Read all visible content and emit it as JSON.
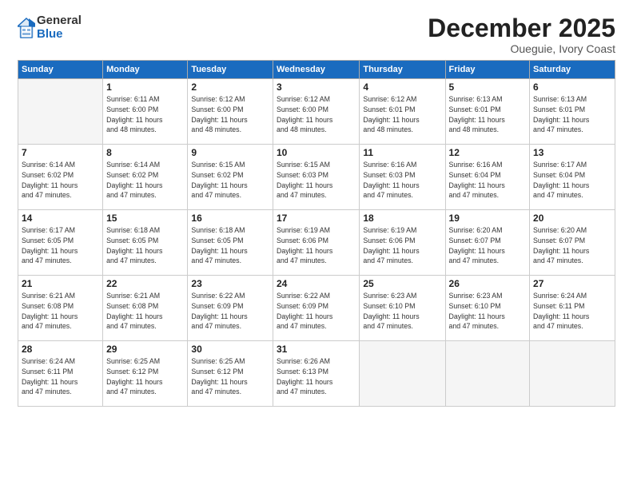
{
  "logo": {
    "general": "General",
    "blue": "Blue"
  },
  "title": "December 2025",
  "location": "Oueguie, Ivory Coast",
  "days_header": [
    "Sunday",
    "Monday",
    "Tuesday",
    "Wednesday",
    "Thursday",
    "Friday",
    "Saturday"
  ],
  "weeks": [
    [
      {
        "day": "",
        "info": ""
      },
      {
        "day": "1",
        "info": "Sunrise: 6:11 AM\nSunset: 6:00 PM\nDaylight: 11 hours\nand 48 minutes."
      },
      {
        "day": "2",
        "info": "Sunrise: 6:12 AM\nSunset: 6:00 PM\nDaylight: 11 hours\nand 48 minutes."
      },
      {
        "day": "3",
        "info": "Sunrise: 6:12 AM\nSunset: 6:00 PM\nDaylight: 11 hours\nand 48 minutes."
      },
      {
        "day": "4",
        "info": "Sunrise: 6:12 AM\nSunset: 6:01 PM\nDaylight: 11 hours\nand 48 minutes."
      },
      {
        "day": "5",
        "info": "Sunrise: 6:13 AM\nSunset: 6:01 PM\nDaylight: 11 hours\nand 48 minutes."
      },
      {
        "day": "6",
        "info": "Sunrise: 6:13 AM\nSunset: 6:01 PM\nDaylight: 11 hours\nand 47 minutes."
      }
    ],
    [
      {
        "day": "7",
        "info": "Sunrise: 6:14 AM\nSunset: 6:02 PM\nDaylight: 11 hours\nand 47 minutes."
      },
      {
        "day": "8",
        "info": "Sunrise: 6:14 AM\nSunset: 6:02 PM\nDaylight: 11 hours\nand 47 minutes."
      },
      {
        "day": "9",
        "info": "Sunrise: 6:15 AM\nSunset: 6:02 PM\nDaylight: 11 hours\nand 47 minutes."
      },
      {
        "day": "10",
        "info": "Sunrise: 6:15 AM\nSunset: 6:03 PM\nDaylight: 11 hours\nand 47 minutes."
      },
      {
        "day": "11",
        "info": "Sunrise: 6:16 AM\nSunset: 6:03 PM\nDaylight: 11 hours\nand 47 minutes."
      },
      {
        "day": "12",
        "info": "Sunrise: 6:16 AM\nSunset: 6:04 PM\nDaylight: 11 hours\nand 47 minutes."
      },
      {
        "day": "13",
        "info": "Sunrise: 6:17 AM\nSunset: 6:04 PM\nDaylight: 11 hours\nand 47 minutes."
      }
    ],
    [
      {
        "day": "14",
        "info": "Sunrise: 6:17 AM\nSunset: 6:05 PM\nDaylight: 11 hours\nand 47 minutes."
      },
      {
        "day": "15",
        "info": "Sunrise: 6:18 AM\nSunset: 6:05 PM\nDaylight: 11 hours\nand 47 minutes."
      },
      {
        "day": "16",
        "info": "Sunrise: 6:18 AM\nSunset: 6:05 PM\nDaylight: 11 hours\nand 47 minutes."
      },
      {
        "day": "17",
        "info": "Sunrise: 6:19 AM\nSunset: 6:06 PM\nDaylight: 11 hours\nand 47 minutes."
      },
      {
        "day": "18",
        "info": "Sunrise: 6:19 AM\nSunset: 6:06 PM\nDaylight: 11 hours\nand 47 minutes."
      },
      {
        "day": "19",
        "info": "Sunrise: 6:20 AM\nSunset: 6:07 PM\nDaylight: 11 hours\nand 47 minutes."
      },
      {
        "day": "20",
        "info": "Sunrise: 6:20 AM\nSunset: 6:07 PM\nDaylight: 11 hours\nand 47 minutes."
      }
    ],
    [
      {
        "day": "21",
        "info": "Sunrise: 6:21 AM\nSunset: 6:08 PM\nDaylight: 11 hours\nand 47 minutes."
      },
      {
        "day": "22",
        "info": "Sunrise: 6:21 AM\nSunset: 6:08 PM\nDaylight: 11 hours\nand 47 minutes."
      },
      {
        "day": "23",
        "info": "Sunrise: 6:22 AM\nSunset: 6:09 PM\nDaylight: 11 hours\nand 47 minutes."
      },
      {
        "day": "24",
        "info": "Sunrise: 6:22 AM\nSunset: 6:09 PM\nDaylight: 11 hours\nand 47 minutes."
      },
      {
        "day": "25",
        "info": "Sunrise: 6:23 AM\nSunset: 6:10 PM\nDaylight: 11 hours\nand 47 minutes."
      },
      {
        "day": "26",
        "info": "Sunrise: 6:23 AM\nSunset: 6:10 PM\nDaylight: 11 hours\nand 47 minutes."
      },
      {
        "day": "27",
        "info": "Sunrise: 6:24 AM\nSunset: 6:11 PM\nDaylight: 11 hours\nand 47 minutes."
      }
    ],
    [
      {
        "day": "28",
        "info": "Sunrise: 6:24 AM\nSunset: 6:11 PM\nDaylight: 11 hours\nand 47 minutes."
      },
      {
        "day": "29",
        "info": "Sunrise: 6:25 AM\nSunset: 6:12 PM\nDaylight: 11 hours\nand 47 minutes."
      },
      {
        "day": "30",
        "info": "Sunrise: 6:25 AM\nSunset: 6:12 PM\nDaylight: 11 hours\nand 47 minutes."
      },
      {
        "day": "31",
        "info": "Sunrise: 6:26 AM\nSunset: 6:13 PM\nDaylight: 11 hours\nand 47 minutes."
      },
      {
        "day": "",
        "info": ""
      },
      {
        "day": "",
        "info": ""
      },
      {
        "day": "",
        "info": ""
      }
    ]
  ]
}
